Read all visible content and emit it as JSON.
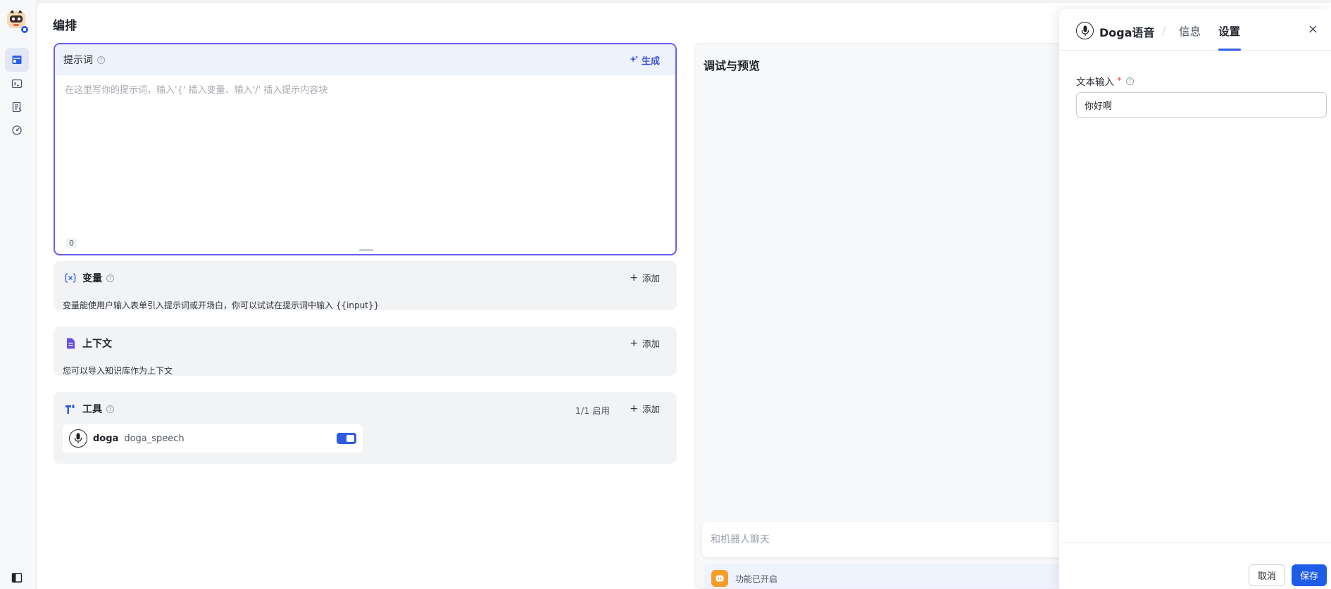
{
  "page": {
    "title": "编排"
  },
  "prompt": {
    "title": "提示词",
    "generate_label": "生成",
    "placeholder": "在这里写你的提示词，输入'{' 插入变量、输入'/' 插入提示内容块",
    "value": "",
    "char_count": "0"
  },
  "variables": {
    "title": "变量",
    "add_label": "添加",
    "description": "变量能使用户输入表单引入提示词或开场白，你可以试试在提示词中输入 {{input}}"
  },
  "context": {
    "title": "上下文",
    "add_label": "添加",
    "description": "您可以导入知识库作为上下文"
  },
  "tools": {
    "title": "工具",
    "enabled_count": "1/1 启用",
    "add_label": "添加",
    "items": [
      {
        "name": "doga",
        "id": "doga_speech",
        "enabled": true
      }
    ]
  },
  "preview": {
    "title": "调试与预览",
    "chat_placeholder": "和机器人聊天",
    "feature_status": "功能已开启"
  },
  "drawer": {
    "tool_name": "Doga语音",
    "tabs": [
      "信息",
      "设置"
    ],
    "active_tab": "设置",
    "field_label": "文本输入",
    "required_mark": "*",
    "field_value": "你好啊",
    "cancel_label": "取消",
    "save_label": "保存"
  },
  "colors": {
    "accent": "#2d5be6",
    "prompt_border": "#6a5cf0",
    "feature_icon": "#f59d2a",
    "required": "#f54a45"
  },
  "icons": {
    "rail": [
      "layout-icon",
      "terminal-icon",
      "document-icon",
      "monitor-gauge-icon",
      "sidebar-toggle-icon"
    ]
  }
}
